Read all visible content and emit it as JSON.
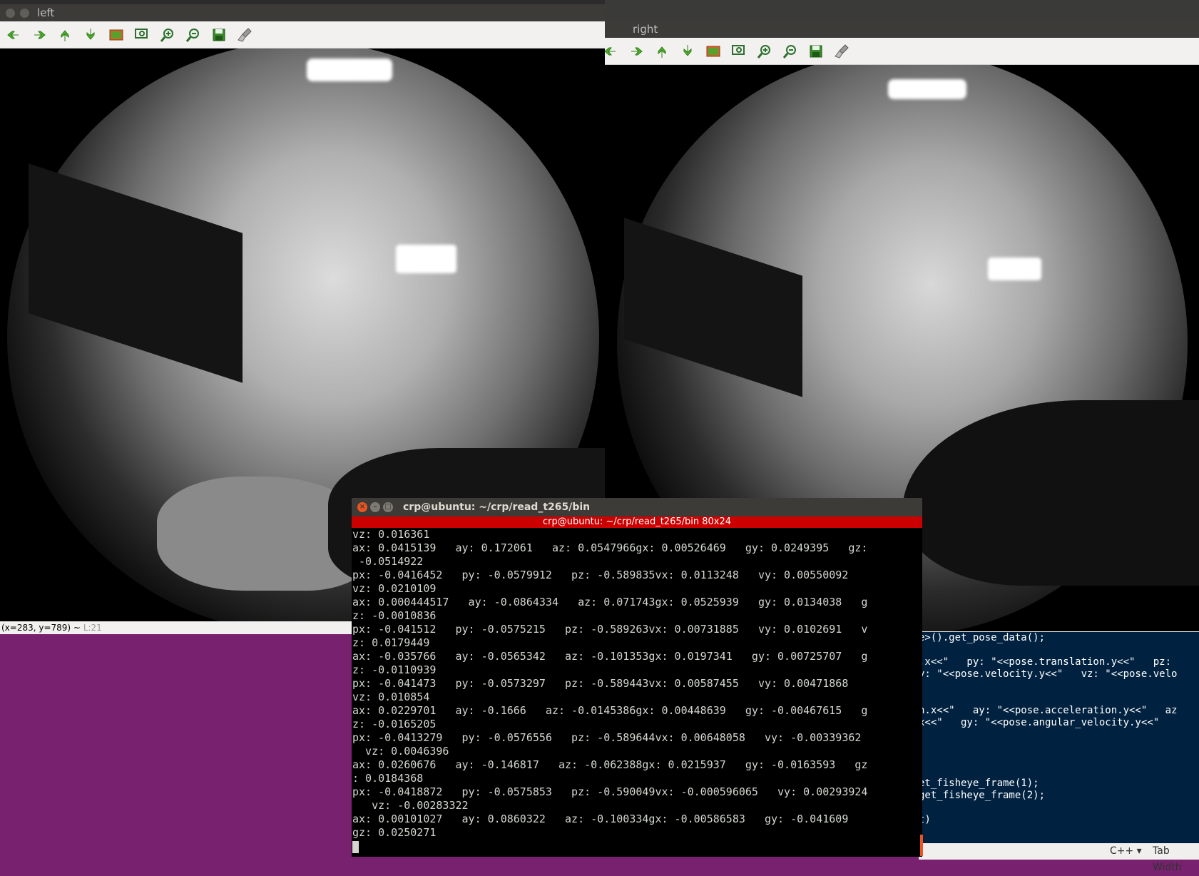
{
  "background": {
    "desktop_color": "#77216F",
    "editor": {
      "lines": [
        "e>().get_pose_data();",
        ".x<<\"   py: \"<<pose.translation.y<<\"   pz:",
        "y: \"<<pose.velocity.y<<\"   vz: \"<<pose.velo",
        "",
        "",
        "n.x<<\"   ay: \"<<pose.acceleration.y<<\"   az",
        "x<<\"   gy: \"<<pose.angular_velocity.y<<\"",
        "",
        "",
        "",
        "et_fisheye_frame(1);",
        "get_fisheye_frame(2);",
        "",
        "t)"
      ],
      "status_language": "C++ ▾",
      "status_tab": "Tab Width"
    }
  },
  "left_window": {
    "title": "left",
    "status": "(x=283, y=789) ~",
    "status_level": "L:21"
  },
  "right_window": {
    "title": "right"
  },
  "toolbar_icons": [
    "arrow-left-icon",
    "arrow-right-icon",
    "arrow-up-icon",
    "arrow-down-icon",
    "image-icon",
    "zoom-fit-icon",
    "zoom-in-icon",
    "zoom-out-icon",
    "save-icon",
    "brush-icon"
  ],
  "terminal": {
    "title": "crp@ubuntu: ~/crp/read_t265/bin",
    "tab_label": "crp@ubuntu: ~/crp/read_t265/bin 80x24",
    "lines": [
      "vz: 0.016361",
      "ax: 0.0415139   ay: 0.172061   az: 0.0547966gx: 0.00526469   gy: 0.0249395   gz:",
      " -0.0514922",
      "px: -0.0416452   py: -0.0579912   pz: -0.589835vx: 0.0113248   vy: 0.00550092",
      "vz: 0.0210109",
      "ax: 0.000444517   ay: -0.0864334   az: 0.071743gx: 0.0525939   gy: 0.0134038   g",
      "z: -0.0010836",
      "px: -0.041512   py: -0.0575215   pz: -0.589263vx: 0.00731885   vy: 0.0102691   v",
      "z: 0.0179449",
      "ax: -0.035766   ay: -0.0565342   az: -0.101353gx: 0.0197341   gy: 0.00725707   g",
      "z: -0.0110939",
      "px: -0.041473   py: -0.0573297   pz: -0.589443vx: 0.00587455   vy: 0.00471868",
      "vz: 0.010854",
      "ax: 0.0229701   ay: -0.1666   az: -0.0145386gx: 0.00448639   gy: -0.00467615   g",
      "z: -0.0165205",
      "px: -0.0413279   py: -0.0576556   pz: -0.589644vx: 0.00648058   vy: -0.00339362",
      "  vz: 0.0046396",
      "ax: 0.0260676   ay: -0.146817   az: -0.062388gx: 0.0215937   gy: -0.0163593   gz",
      ": 0.0184368",
      "px: -0.0418872   py: -0.0575853   pz: -0.590049vx: -0.000596065   vy: 0.00293924",
      "   vz: -0.00283322",
      "ax: 0.00101027   ay: 0.0860322   az: -0.100334gx: -0.00586583   gy: -0.041609",
      "gz: 0.0250271"
    ]
  }
}
